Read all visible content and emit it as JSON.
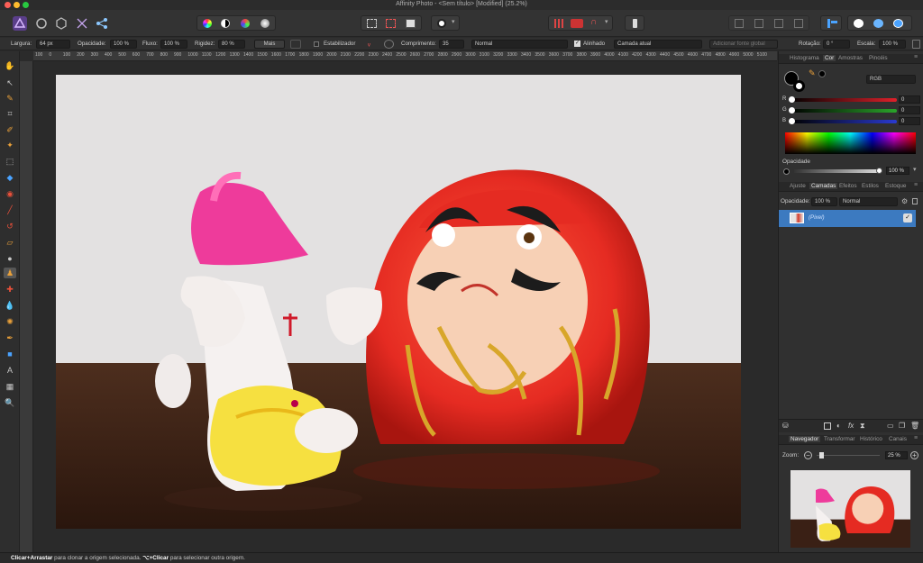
{
  "window": {
    "title": "Affinity Photo - <Sem título> [Modified] (25.2%)"
  },
  "context_bar": {
    "width_label": "Largura:",
    "width_value": "64 px",
    "opacity_label": "Opacidade:",
    "opacity_value": "100 %",
    "flow_label": "Fluxo:",
    "flow_value": "100 %",
    "hardness_label": "Rigidez:",
    "hardness_value": "80 %",
    "more_label": "Mais",
    "stabilizer_label": "Estabilizador",
    "length_label": "Comprimento:",
    "length_value": "35",
    "blend_mode": "Normal",
    "aligned_label": "Alinhado",
    "source_layer": "Camada atual",
    "add_source_label": "Adicionar fonte global",
    "rotation_label": "Rotação:",
    "rotation_value": "0 °",
    "scale_label": "Escala:",
    "scale_value": "100 %"
  },
  "ruler_ticks": [
    "100",
    "0",
    "100",
    "200",
    "300",
    "400",
    "500",
    "600",
    "700",
    "800",
    "900",
    "1000",
    "1100",
    "1200",
    "1300",
    "1400",
    "1500",
    "1600",
    "1700",
    "1800",
    "1900",
    "2000",
    "2100",
    "2200",
    "2300",
    "2400",
    "2500",
    "2600",
    "2700",
    "2800",
    "2900",
    "3000",
    "3100",
    "3200",
    "3300",
    "3400",
    "3500",
    "3600",
    "3700",
    "3800",
    "3900",
    "4000",
    "4100",
    "4200",
    "4300",
    "4400",
    "4500",
    "4600",
    "4700",
    "4800",
    "4900",
    "5000",
    "5100"
  ],
  "color_panel": {
    "tabs": [
      "Histograma",
      "Cor",
      "Amostras",
      "Pincéis"
    ],
    "active_tab": "Cor",
    "model": "RGB",
    "channels": [
      {
        "label": "R",
        "value": "0",
        "color": "#e0202a"
      },
      {
        "label": "G",
        "value": "0",
        "color": "#2aa52a"
      },
      {
        "label": "B",
        "value": "0",
        "color": "#2a3ad0"
      }
    ],
    "opacity_label": "Opacidade",
    "opacity_value": "100 %"
  },
  "layers_panel": {
    "tabs": [
      "Ajuste",
      "Camadas",
      "Efeitos",
      "Estilos",
      "Estoque"
    ],
    "active_tab": "Camadas",
    "opacity_label": "Opacidade:",
    "opacity_value": "100 %",
    "blend_mode": "Normal",
    "layers": [
      {
        "name": "(Pixel)",
        "visible": true
      }
    ]
  },
  "navigator_panel": {
    "tabs": [
      "Navegador",
      "Transformar",
      "Histórico",
      "Canais"
    ],
    "active_tab": "Navegador",
    "zoom_label": "Zoom:",
    "zoom_value": "25 %"
  },
  "status": {
    "key1": "Clicar+Arrastar",
    "text1": " para clonar a origem selecionada. ",
    "key2": "⌥+Clicar",
    "text2": " para selecionar outra origem."
  }
}
